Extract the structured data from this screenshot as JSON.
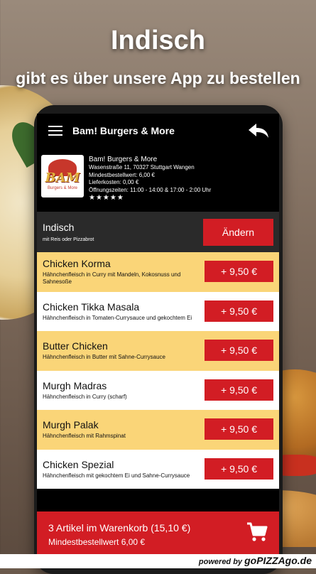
{
  "headline": {
    "title": "Indisch",
    "subtitle": "gibt es über unsere App zu bestellen"
  },
  "appbar": {
    "title": "Bam! Burgers & More",
    "menu_icon": "hamburger-menu-icon",
    "back_icon": "reply-back-arrow-icon"
  },
  "restaurant": {
    "logo_text": "BAM",
    "logo_subtext": "Burgers & More",
    "name": "Bam! Burgers & More",
    "address": "Wasenstraße 11, 70327 Stuttgart Wangen",
    "min_order": "Mindestbestellwert: 6,00 €",
    "delivery_cost": "Lieferkosten: 0,00 €",
    "opening_hours": "Öffnungszeiten: 11:00 - 14:00 & 17:00 - 2:00 Uhr",
    "rating": 5,
    "stars": "★★★★★"
  },
  "category": {
    "name": "Indisch",
    "description": "mit Reis oder Pizzabrot",
    "change_label": "Ändern"
  },
  "items": [
    {
      "name": "Chicken Korma",
      "description": "Hähnchenfleisch in Curry mit Mandeln, Kokosnuss und Sahnesoße",
      "price": "+ 9,50 €"
    },
    {
      "name": "Chicken Tikka Masala",
      "description": "Hähnchenfleisch in Tomaten-Currysauce und gekochtem Ei",
      "price": "+ 9,50 €"
    },
    {
      "name": "Butter Chicken",
      "description": "Hähnchenfleisch in Butter mit Sahne-Currysauce",
      "price": "+ 9,50 €"
    },
    {
      "name": "Murgh Madras",
      "description": "Hähnchenfleisch in Curry (scharf)",
      "price": "+ 9,50 €"
    },
    {
      "name": "Murgh Palak",
      "description": "Hähnchenfleisch mit Rahmspinat",
      "price": "+ 9,50 €"
    },
    {
      "name": "Chicken Spezial",
      "description": "Hähnchenfleisch mit gekochtem Ei und Sahne-Currysauce",
      "price": "+ 9,50 €"
    }
  ],
  "cart": {
    "summary": "3 Artikel im Warenkorb (15,10 €)",
    "min_order": "Mindestbestellwert 6,00 €",
    "icon": "shopping-cart-icon"
  },
  "footer": {
    "powered_by": "powered by",
    "brand": "goPIZZAgo.de"
  },
  "colors": {
    "accent_red": "#d21d24",
    "item_yellow": "#fad578",
    "item_white": "#ffffff",
    "category_bar": "#2a2a2a"
  }
}
